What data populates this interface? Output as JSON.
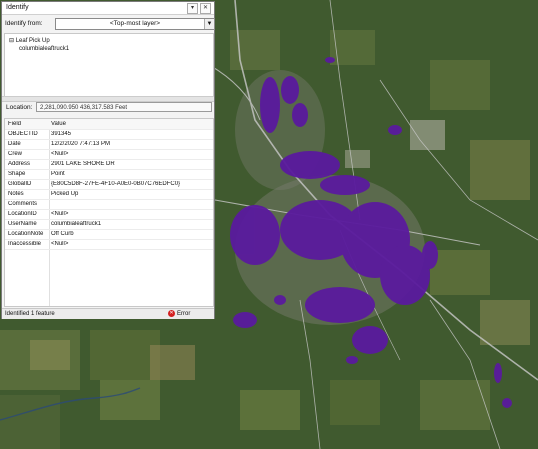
{
  "window": {
    "title": "Identify"
  },
  "identify_from": {
    "label": "Identify from:",
    "value": "<Top-most layer>"
  },
  "tree": {
    "layer": "Leaf Pick Up",
    "item": "columbialeaftruck1"
  },
  "location": {
    "label": "Location:",
    "value": "2,281,090.950  436,317.583 Feet"
  },
  "grid": {
    "header": {
      "field": "Field",
      "value": "Value"
    },
    "rows": [
      {
        "field": "OBJECTID",
        "value": "391345"
      },
      {
        "field": "Date",
        "value": "12/2/2020 7:47:13 PM"
      },
      {
        "field": "Crew",
        "value": "<Null>"
      },
      {
        "field": "Address",
        "value": "2901 LAKE SHORE DR"
      },
      {
        "field": "Shape",
        "value": "Point"
      },
      {
        "field": "GlobalID",
        "value": "{E80C5D8F-27FE-4F10-A0E0-0B07C76EDFC0}"
      },
      {
        "field": "Notes",
        "value": "Picked Up"
      },
      {
        "field": "Comments",
        "value": ""
      },
      {
        "field": "LocationID",
        "value": "<Null>"
      },
      {
        "field": "UserName",
        "value": "columbialeaftruck1"
      },
      {
        "field": "LocationNote",
        "value": "Off Curb"
      },
      {
        "field": "Inaccessible",
        "value": "<Null>"
      }
    ]
  },
  "status": {
    "text": "Identified 1 feature",
    "error_label": "Error"
  },
  "colors": {
    "points": "#5a1a9e",
    "roads": "#c9c9c9"
  }
}
